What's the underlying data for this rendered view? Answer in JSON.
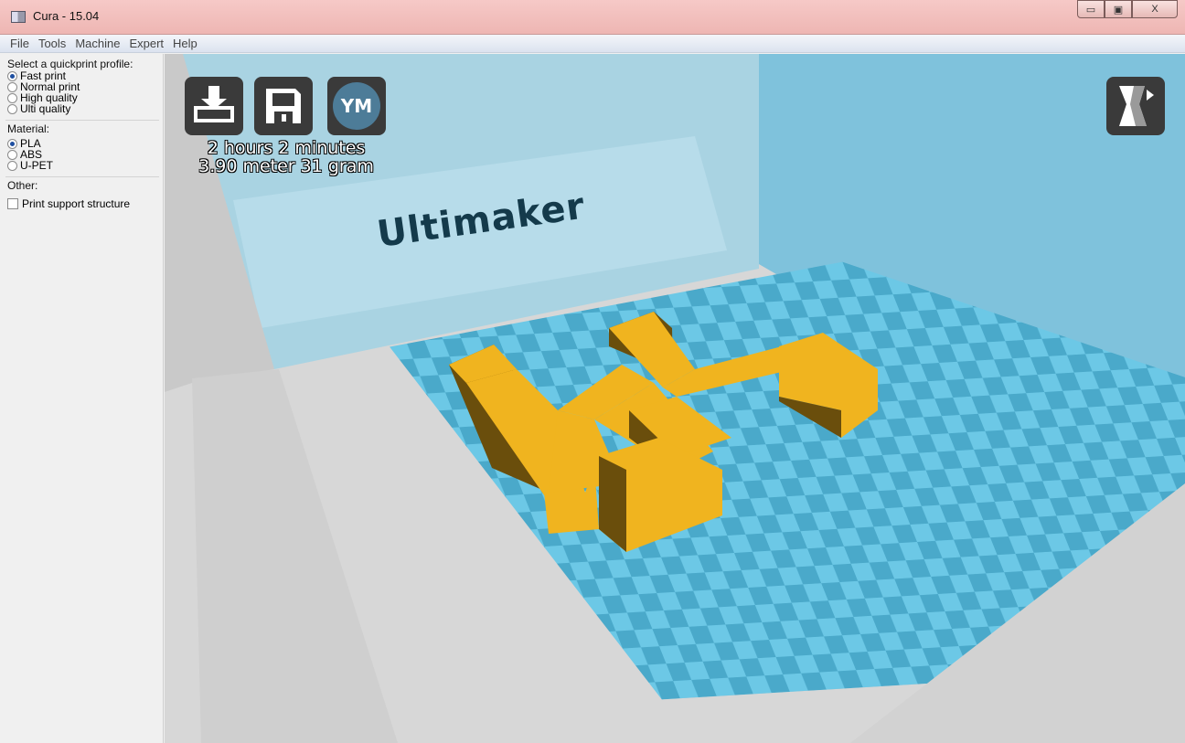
{
  "window": {
    "title": "Cura - 15.04",
    "controls": {
      "minimize": "▭",
      "maximize": "▣",
      "close": "X"
    }
  },
  "menu": [
    "File",
    "Tools",
    "Machine",
    "Expert",
    "Help"
  ],
  "sidebar": {
    "profile_label": "Select a quickprint profile:",
    "profiles": [
      {
        "label": "Fast print",
        "checked": true
      },
      {
        "label": "Normal print",
        "checked": false
      },
      {
        "label": "High quality",
        "checked": false
      },
      {
        "label": "Ulti quality",
        "checked": false
      }
    ],
    "material_label": "Material:",
    "materials": [
      {
        "label": "PLA",
        "checked": true
      },
      {
        "label": "ABS",
        "checked": false
      },
      {
        "label": "U-PET",
        "checked": false
      }
    ],
    "other_label": "Other:",
    "support_label": "Print support structure",
    "support_checked": false
  },
  "viewport": {
    "print_time": "2 hours 2 minutes",
    "print_usage": "3.90 meter 31 gram",
    "brand_text": "Ultimaker",
    "toolbar": {
      "load_icon": "load-model-icon",
      "save_icon": "save-disk-icon",
      "ym_label": "YM",
      "view_icon": "view-mode-icon"
    },
    "colors": {
      "bed_light": "#6cc8e6",
      "bed_dark": "#4aa9ca",
      "model_top": "#f0b41f",
      "model_side": "#6a4e0c",
      "back_wall": "#a9d3e2",
      "right_wall": "#7fc2dc"
    }
  }
}
